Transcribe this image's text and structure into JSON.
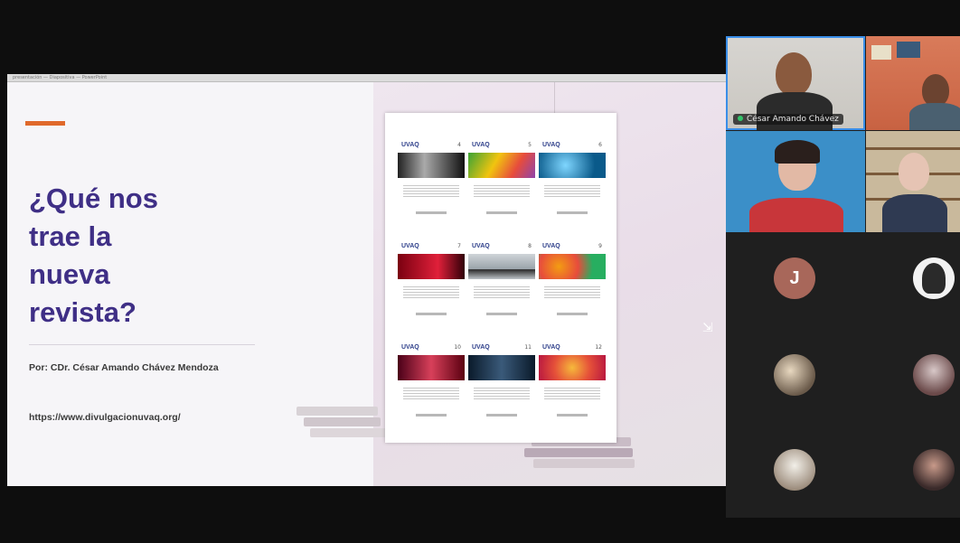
{
  "window": {
    "share_bar_text": "presentación — Diapositiva — PowerPoint"
  },
  "slide": {
    "title": "¿Qué nos\ntrae la\nnueva\nrevista?",
    "author": "Por: CDr. César Amando Chávez Mendoza",
    "url": "https://www.divulgacionuvaq.org/",
    "accent_color": "#e0692b",
    "title_color": "#3f2f86"
  },
  "poster": {
    "covers": [
      {
        "logo": "UVAQ",
        "number": "4"
      },
      {
        "logo": "UVAQ",
        "number": "5"
      },
      {
        "logo": "UVAQ",
        "number": "6"
      },
      {
        "logo": "UVAQ",
        "number": "7"
      },
      {
        "logo": "UVAQ",
        "number": "8"
      },
      {
        "logo": "UVAQ",
        "number": "9"
      },
      {
        "logo": "UVAQ",
        "number": "10"
      },
      {
        "logo": "UVAQ",
        "number": "11"
      },
      {
        "logo": "UVAQ",
        "number": "12"
      }
    ]
  },
  "participants": {
    "active_speaker_name": "César Amando Chávez",
    "avatar_letter": "J"
  }
}
